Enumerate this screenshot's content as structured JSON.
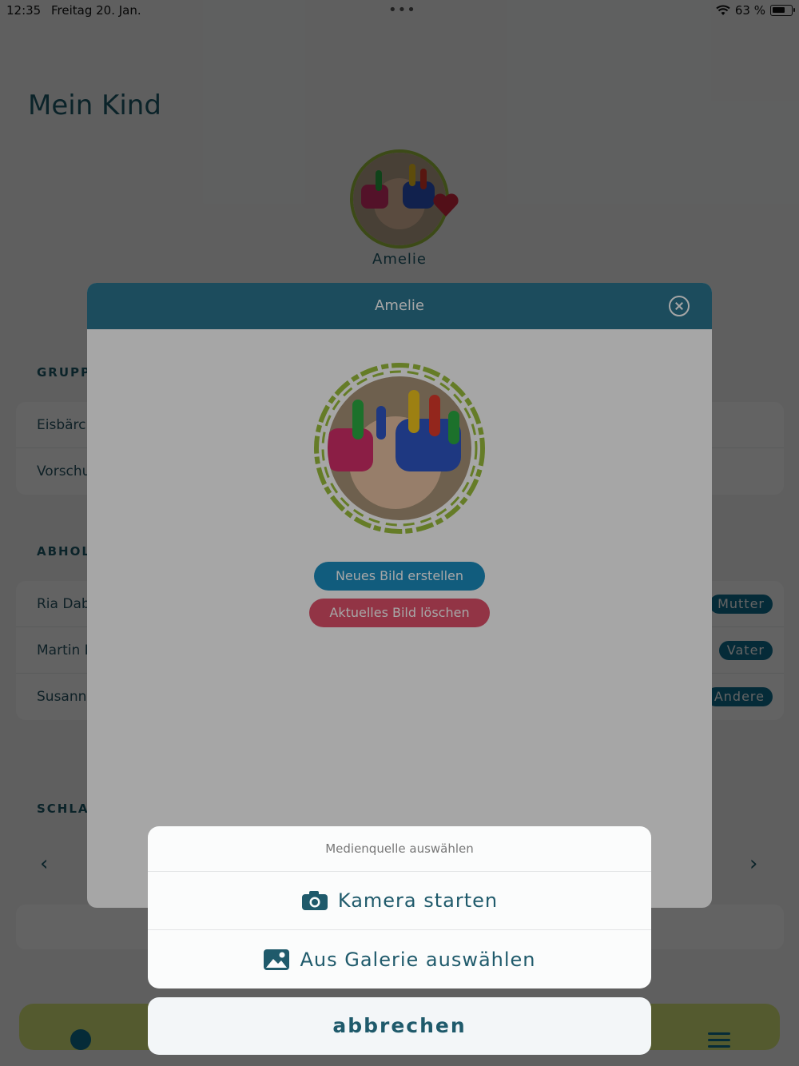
{
  "status_bar": {
    "time": "12:35",
    "date": "Freitag 20. Jan.",
    "battery": "63 %"
  },
  "page": {
    "title": "Mein Kind",
    "child_name": "Amelie"
  },
  "sections": {
    "groups": {
      "label": "GRUPP",
      "rows": [
        "Eisbärc",
        "Vorschu"
      ]
    },
    "pickup": {
      "label": "ABHOL",
      "rows": [
        {
          "name": "Ria Dab",
          "role": "Mutter"
        },
        {
          "name": "Martin I",
          "role": "Vater"
        },
        {
          "name": "Susann",
          "role": "Andere"
        }
      ]
    },
    "sleep": {
      "label": "SCHLAF"
    }
  },
  "modal": {
    "title": "Amelie",
    "new_button": "Neues Bild erstellen",
    "delete_button": "Aktuelles Bild löschen"
  },
  "action_sheet": {
    "title": "Medienquelle auswählen",
    "camera": "Kamera starten",
    "gallery": "Aus Galerie auswählen",
    "cancel": "abbrechen"
  },
  "icons": {
    "camera": "camera-icon",
    "gallery": "image-icon",
    "close": "close-icon",
    "heart": "heart-icon",
    "wifi": "wifi-icon",
    "battery": "battery-icon",
    "list": "list-icon",
    "menu": "menu-icon",
    "chevron_left": "chevron-left-icon",
    "chevron_right": "chevron-right-icon"
  },
  "colors": {
    "header": "#2b7690",
    "primary_button": "#1b8ec0",
    "danger_button": "#e0506a",
    "accent_green": "#9cbf3c",
    "text_dark": "#1f5a6b"
  }
}
